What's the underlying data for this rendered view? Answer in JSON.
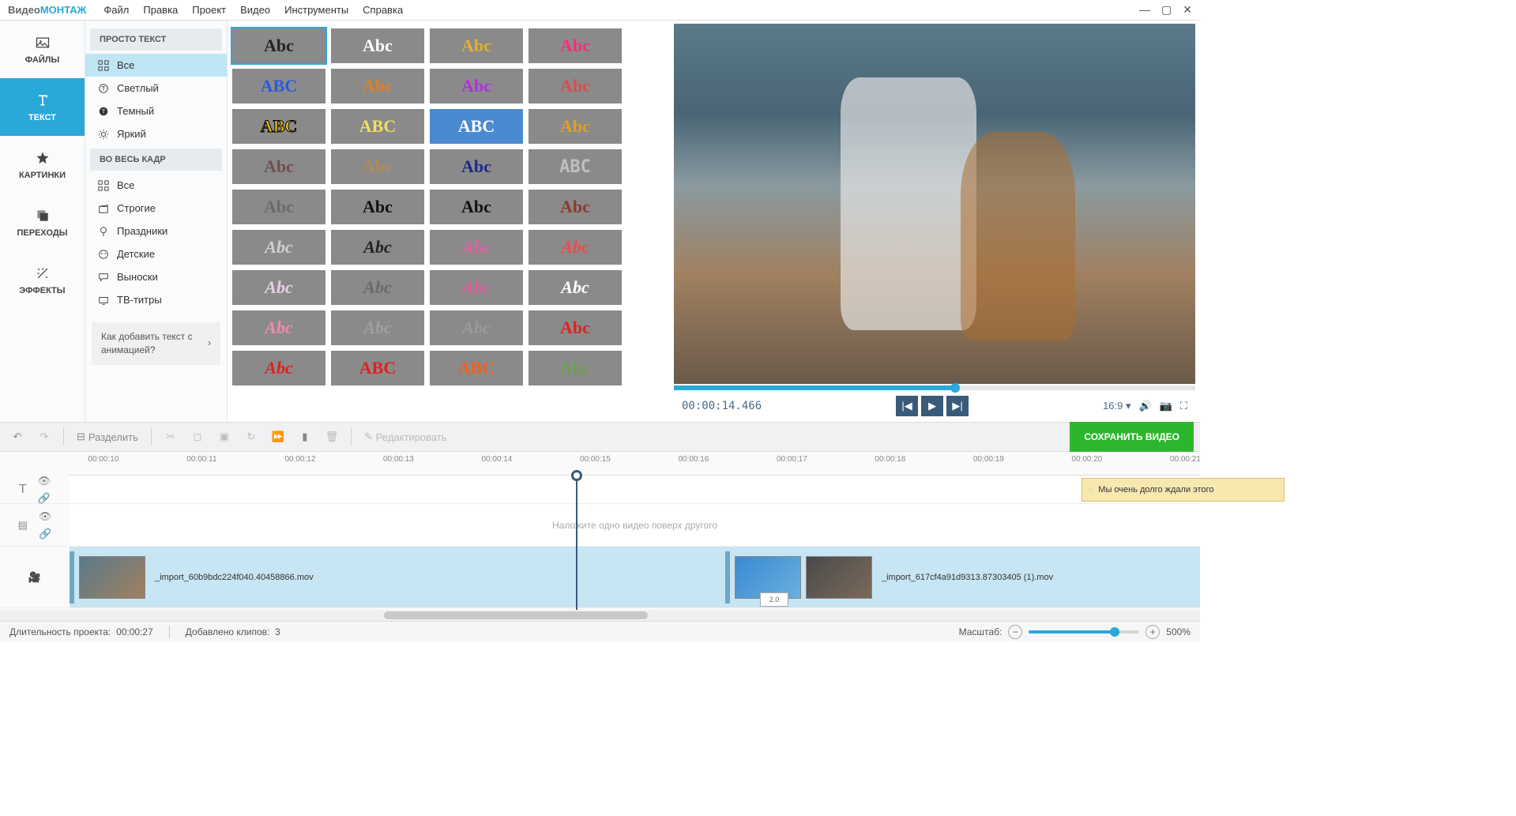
{
  "app": {
    "logo1": "Видео",
    "logo2": "МОНТАЖ"
  },
  "menu": [
    "Файл",
    "Правка",
    "Проект",
    "Видео",
    "Инструменты",
    "Справка"
  ],
  "lefttabs": [
    {
      "id": "files",
      "label": "ФАЙЛЫ",
      "active": false
    },
    {
      "id": "text",
      "label": "ТЕКСТ",
      "active": true
    },
    {
      "id": "images",
      "label": "КАРТИНКИ",
      "active": false
    },
    {
      "id": "transitions",
      "label": "ПЕРЕХОДЫ",
      "active": false
    },
    {
      "id": "effects",
      "label": "ЭФФЕКТЫ",
      "active": false
    }
  ],
  "cats": {
    "hdr1": "ПРОСТО ТЕКСТ",
    "group1": [
      {
        "id": "all",
        "label": "Все",
        "active": true
      },
      {
        "id": "light",
        "label": "Светлый"
      },
      {
        "id": "dark",
        "label": "Темный"
      },
      {
        "id": "bright",
        "label": "Яркий"
      }
    ],
    "hdr2": "ВО ВЕСЬ КАДР",
    "group2": [
      {
        "id": "all2",
        "label": "Все"
      },
      {
        "id": "strict",
        "label": "Строгие"
      },
      {
        "id": "holiday",
        "label": "Праздники"
      },
      {
        "id": "kids",
        "label": "Детские"
      },
      {
        "id": "callout",
        "label": "Выноски"
      },
      {
        "id": "tv",
        "label": "ТВ-титры"
      }
    ],
    "help": "Как добавить текст с анимацией?"
  },
  "thumbs": [
    [
      {
        "t": "Abc",
        "c": "#222",
        "bg": "#8a8a8a",
        "sel": true
      },
      {
        "t": "Abc",
        "c": "#fff"
      },
      {
        "t": "Abc",
        "c": "#e0b030",
        "ff": "cursive"
      },
      {
        "t": "Abc",
        "c": "#ff2a7a",
        "fw": "900"
      }
    ],
    [
      {
        "t": "ABC",
        "c": "#2a5ae0",
        "fw": "900"
      },
      {
        "t": "Abc",
        "c": "#e08020"
      },
      {
        "t": "Abc",
        "c": "#b030e0"
      },
      {
        "t": "Abc",
        "c": "#e04a4a",
        "ff": "serif"
      }
    ],
    [
      {
        "t": "ABC",
        "c": "#e0c020",
        "fw": "900",
        "st": "#000"
      },
      {
        "t": "ABC",
        "c": "#f0e060",
        "fw": "900"
      },
      {
        "t": "ABC",
        "c": "#fff",
        "bg": "#4a8ad0"
      },
      {
        "t": "Abc",
        "c": "#e0a020",
        "ff": "serif"
      }
    ],
    [
      {
        "t": "Abc",
        "c": "#705050"
      },
      {
        "t": "Abc",
        "c": "#b08a5a"
      },
      {
        "t": "Abc",
        "c": "#1a2a8a",
        "fw": "900"
      },
      {
        "t": "ABC",
        "c": "#c0c0c0",
        "ff": "monospace"
      }
    ],
    [
      {
        "t": "Abc",
        "c": "#6a6a6a",
        "ff": "serif"
      },
      {
        "t": "Abc",
        "c": "#111"
      },
      {
        "t": "Abc",
        "c": "#111",
        "fw": "900"
      },
      {
        "t": "Abc",
        "c": "#8a3a2a",
        "ff": "serif"
      }
    ],
    [
      {
        "t": "Abc",
        "c": "#d0d0d0",
        "ff": "cursive",
        "fs": "italic"
      },
      {
        "t": "Abc",
        "c": "#222",
        "ff": "cursive",
        "fs": "italic"
      },
      {
        "t": "Abc",
        "c": "#e060a0",
        "ff": "cursive",
        "fs": "italic"
      },
      {
        "t": "Abc",
        "c": "#f04a4a",
        "ff": "cursive",
        "fs": "italic"
      }
    ],
    [
      {
        "t": "Abc",
        "c": "#e8d0e8",
        "ff": "cursive",
        "fs": "italic"
      },
      {
        "t": "Abc",
        "c": "#6a6a6a",
        "ff": "cursive",
        "fs": "italic"
      },
      {
        "t": "Abc",
        "c": "#e05a9a",
        "ff": "cursive",
        "fs": "italic"
      },
      {
        "t": "Abc",
        "c": "#fff",
        "ff": "cursive",
        "fs": "italic"
      }
    ],
    [
      {
        "t": "Abc",
        "c": "#f08aa8",
        "ff": "cursive",
        "fs": "italic"
      },
      {
        "t": "Abc",
        "c": "#a0a0a0",
        "ff": "cursive",
        "fs": "italic"
      },
      {
        "t": "Abc",
        "c": "#9a9a9a",
        "ff": "cursive",
        "fs": "italic"
      },
      {
        "t": "Abc",
        "c": "#e02020",
        "fw": "900"
      }
    ],
    [
      {
        "t": "Abc",
        "c": "#e02020",
        "fw": "900",
        "fs": "italic"
      },
      {
        "t": "ABC",
        "c": "#e02020",
        "fw": "900"
      },
      {
        "t": "ABC",
        "c": "#f06020",
        "fw": "900"
      },
      {
        "t": "Abc",
        "c": "#6aa050",
        "ff": "cursive"
      }
    ]
  ],
  "preview": {
    "timecode": "00:00:14.466",
    "progress_pct": 54,
    "aspect": "16:9"
  },
  "toolbar": {
    "split": "Разделить",
    "edit": "Редактировать",
    "save": "СОХРАНИТЬ ВИДЕО"
  },
  "timeline": {
    "ticks": [
      "00:00:10",
      "00:00:11",
      "00:00:12",
      "00:00:13",
      "00:00:14",
      "00:00:15",
      "00:00:16",
      "00:00:17",
      "00:00:18",
      "00:00:19",
      "00:00:20",
      "00:00:21"
    ],
    "playhead_pct": 42.2,
    "text_clip": {
      "label": "Мы очень долго   ждали этого",
      "left_pct": 89.5,
      "width_pct": 18
    },
    "overlay_hint": "Наложите одно видео поверх другого",
    "clip1": {
      "name": "_import_60b9bdc224f040.40458866.mov",
      "left_pct": 0,
      "width_pct": 65
    },
    "clip2": {
      "name": "_import_617cf4a91d9313.87303405 (1).mov",
      "left_pct": 58,
      "width_pct": 40
    },
    "transition": "2.0",
    "scroll": {
      "left_pct": 32,
      "width_pct": 22
    }
  },
  "status": {
    "duration_label": "Длительность проекта:",
    "duration": "00:00:27",
    "clips_label": "Добавлено клипов:",
    "clips": "3",
    "zoom_label": "Масштаб:",
    "zoom": "500%",
    "zoom_pct": 78
  }
}
